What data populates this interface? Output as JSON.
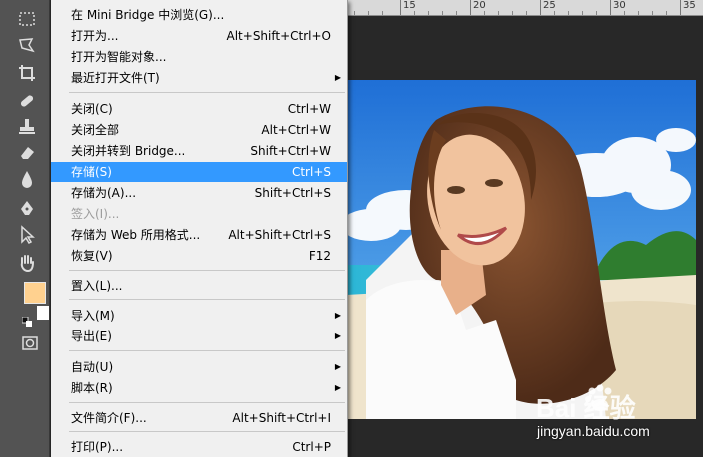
{
  "menu": {
    "items": [
      {
        "label": "在 Mini Bridge 中浏览(G)...",
        "shortcut": "",
        "submenu": false
      },
      {
        "label": "打开为...",
        "shortcut": "Alt+Shift+Ctrl+O",
        "submenu": false
      },
      {
        "label": "打开为智能对象...",
        "shortcut": "",
        "submenu": false
      },
      {
        "label": "最近打开文件(T)",
        "shortcut": "",
        "submenu": true
      },
      {
        "label": "关闭(C)",
        "shortcut": "Ctrl+W",
        "submenu": false
      },
      {
        "label": "关闭全部",
        "shortcut": "Alt+Ctrl+W",
        "submenu": false
      },
      {
        "label": "关闭并转到 Bridge...",
        "shortcut": "Shift+Ctrl+W",
        "submenu": false
      },
      {
        "label": "存储(S)",
        "shortcut": "Ctrl+S",
        "submenu": false,
        "selected": true
      },
      {
        "label": "存储为(A)...",
        "shortcut": "Shift+Ctrl+S",
        "submenu": false
      },
      {
        "label": "签入(I)...",
        "shortcut": "",
        "submenu": false,
        "disabled": true
      },
      {
        "label": "存储为 Web 所用格式...",
        "shortcut": "Alt+Shift+Ctrl+S",
        "submenu": false
      },
      {
        "label": "恢复(V)",
        "shortcut": "F12",
        "submenu": false
      },
      {
        "label": "置入(L)...",
        "shortcut": "",
        "submenu": false
      },
      {
        "label": "导入(M)",
        "shortcut": "",
        "submenu": true
      },
      {
        "label": "导出(E)",
        "shortcut": "",
        "submenu": true
      },
      {
        "label": "自动(U)",
        "shortcut": "",
        "submenu": true
      },
      {
        "label": "脚本(R)",
        "shortcut": "",
        "submenu": true
      },
      {
        "label": "文件简介(F)...",
        "shortcut": "Alt+Shift+Ctrl+I",
        "submenu": false
      },
      {
        "label": "打印(P)...",
        "shortcut": "Ctrl+P",
        "submenu": false
      }
    ]
  },
  "ruler": {
    "labels": [
      "15",
      "20",
      "25",
      "30",
      "35"
    ]
  },
  "toolbar": {
    "tools": [
      "marquee-tool",
      "lasso-tool",
      "crop-tool",
      "healing-brush-tool",
      "stamp-tool",
      "eraser-tool",
      "blur-tool",
      "pen-tool",
      "path-selection-tool",
      "hand-tool"
    ],
    "foreground_color": "#ffd18f",
    "background_color": "#ffffff"
  },
  "watermark": {
    "site": "jingyan.baidu.com",
    "logo_text": "Bai 经验"
  },
  "colors": {
    "menu_bg": "#f0f0f0",
    "selection": "#3399ff",
    "workspace": "#282828",
    "toolbar": "#535353"
  }
}
